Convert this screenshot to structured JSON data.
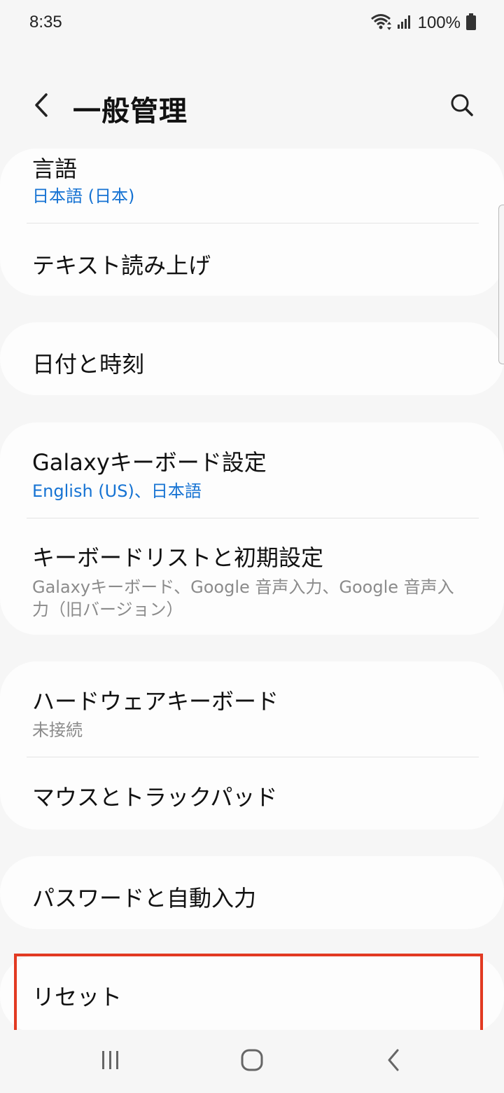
{
  "status_bar": {
    "time": "8:35",
    "battery": "100%",
    "icons": [
      "wifi-icon",
      "signal-icon",
      "battery-icon"
    ]
  },
  "header": {
    "title": "一般管理",
    "back_icon": "chevron-left-icon",
    "search_icon": "search-icon"
  },
  "items": {
    "language": {
      "title": "言語",
      "subtitle": "日本語 (日本)"
    },
    "tts": {
      "title": "テキスト読み上げ"
    },
    "datetime": {
      "title": "日付と時刻"
    },
    "galaxy_keyboard": {
      "title": "Galaxyキーボード設定",
      "subtitle": "English (US)、日本語"
    },
    "keyboard_list": {
      "title": "キーボードリストと初期設定",
      "subtitle_line1": "Galaxyキーボード、Google 音声入力、Google 音声入",
      "subtitle_line2": "力（旧バージョン）"
    },
    "hardware_keyboard": {
      "title": "ハードウェアキーボード",
      "subtitle": "未接続"
    },
    "mouse_trackpad": {
      "title": "マウスとトラックパッド"
    },
    "password_autofill": {
      "title": "パスワードと自動入力"
    },
    "reset": {
      "title": "リセット"
    }
  },
  "nav_bar": {
    "buttons": [
      "recent-apps-icon",
      "home-icon",
      "back-icon"
    ]
  },
  "colors": {
    "accent": "#1673d3",
    "highlight": "#e23a22",
    "background": "#f6f6f6",
    "card": "#fdfdfd"
  }
}
